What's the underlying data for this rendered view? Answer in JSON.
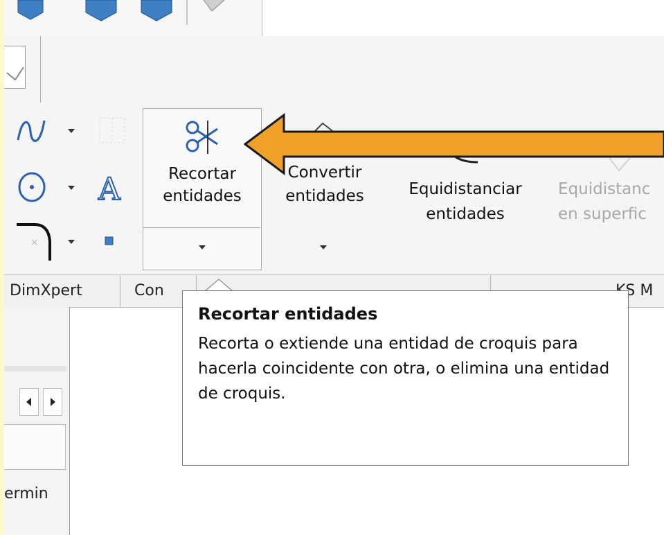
{
  "toolbar": {
    "trim": {
      "label_line1": "Recortar",
      "label_line2": "entidades"
    },
    "convert": {
      "label_line1": "Convertir",
      "label_line2": "entidades"
    },
    "offset": {
      "label_line1": "Equidistanciar",
      "label_line2": "entidades"
    },
    "offset_surface": {
      "label_line1": "Equidistanc",
      "label_line2": "en superfic"
    }
  },
  "tabs": [
    {
      "label": "DimXpert"
    },
    {
      "label": "Con"
    },
    {
      "label": "KS M"
    }
  ],
  "tooltip": {
    "title": "Recortar entidades",
    "body": "Recorta o extiende una entidad de croquis para hacerla coincidente con otra, o elimina una entidad de croquis."
  },
  "left_panel": {
    "truncated_label": "ermin"
  },
  "icons": {
    "spline": "spline-icon",
    "circle": "circle-icon",
    "fillet": "fillet-icon",
    "text": "text-icon",
    "point": "point-icon",
    "trim": "scissors-icon",
    "convert": "convert-entities-icon",
    "offset": "offset-entities-icon"
  },
  "colors": {
    "callout_arrow": "#f0a12a",
    "callout_outline": "#1a1a1a",
    "highlight_bg": "#fff6c9"
  }
}
